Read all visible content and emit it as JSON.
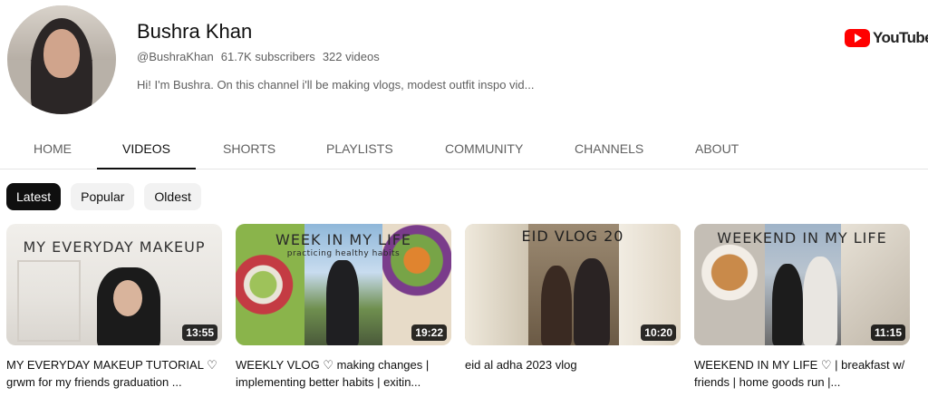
{
  "channel": {
    "name": "Bushra Khan",
    "handle": "@BushraKhan",
    "subscribers": "61.7K subscribers",
    "videos_count": "322 videos",
    "description": "Hi! I'm Bushra. On this channel i'll be making vlogs, modest outfit inspo vid..."
  },
  "logo": {
    "word": "YouTube",
    "color": "#ff0000"
  },
  "tabs": [
    "HOME",
    "VIDEOS",
    "SHORTS",
    "PLAYLISTS",
    "COMMUNITY",
    "CHANNELS",
    "ABOUT"
  ],
  "active_tab": "VIDEOS",
  "chips": [
    "Latest",
    "Popular",
    "Oldest"
  ],
  "active_chip": "Latest",
  "videos": [
    {
      "thumb_text": "MY EVERYDAY MAKEUP",
      "duration": "13:55",
      "title": "MY EVERYDAY MAKEUP TUTORIAL ♡ grwm for my friends graduation ..."
    },
    {
      "thumb_text": "WEEK IN MY LIFE",
      "thumb_subtext": "practicing healthy habits",
      "duration": "19:22",
      "title": "WEEKLY VLOG ♡ making changes | implementing better habits | exitin..."
    },
    {
      "thumb_text": "EID VLOG 20",
      "duration": "10:20",
      "title": "eid al adha 2023 vlog"
    },
    {
      "thumb_text": "WEEKEND IN MY LIFE",
      "duration": "11:15",
      "title": "WEEKEND IN MY LIFE ♡ | breakfast w/ friends | home goods run |..."
    }
  ]
}
